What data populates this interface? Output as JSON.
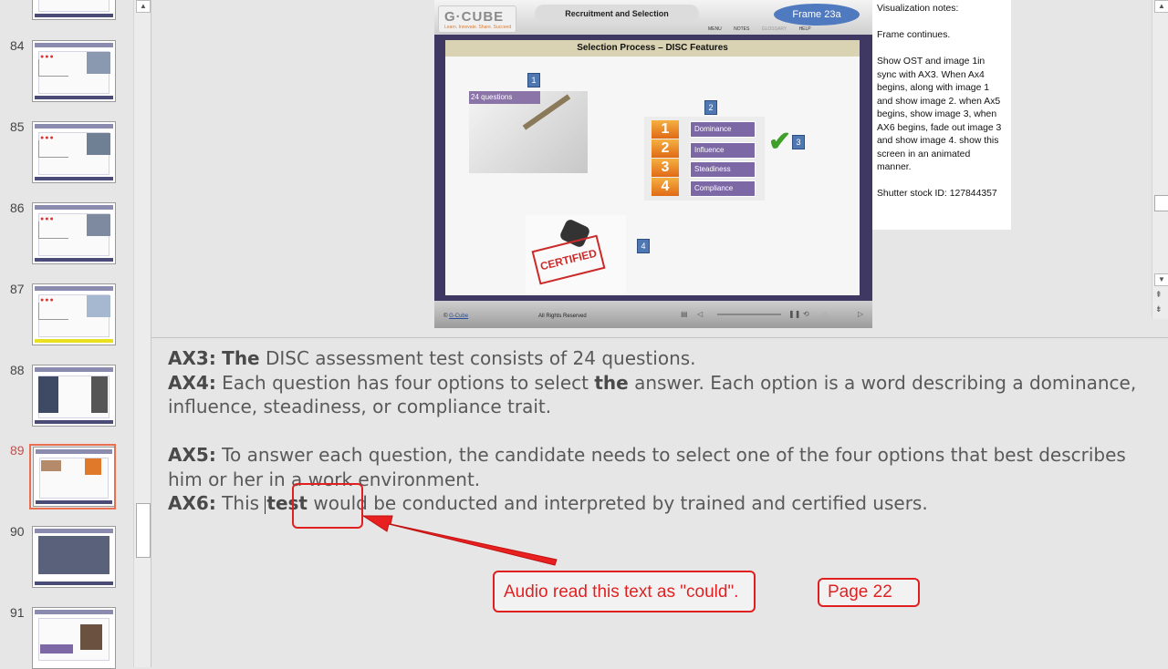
{
  "thumbnails": [
    {
      "number": "84"
    },
    {
      "number": "85"
    },
    {
      "number": "86"
    },
    {
      "number": "87"
    },
    {
      "number": "88"
    },
    {
      "number": "89",
      "selected": true
    },
    {
      "number": "90"
    },
    {
      "number": "91"
    }
  ],
  "slide": {
    "logo": "G·CUBE",
    "logo_tagline": "Learn. Innovate. Share. Succeed",
    "course_title": "Recruitment and Selection",
    "frame_label": "Frame 23a",
    "menu": {
      "menu": "MENU",
      "notes": "NOTES",
      "glossary": "GLOSSARY",
      "help": "HELP"
    },
    "title": "Selection Process – DISC Features",
    "image1_label": "24 questions",
    "markers": [
      "1",
      "2",
      "3",
      "4"
    ],
    "disc_options": [
      {
        "number": "1",
        "label": "Dominance"
      },
      {
        "number": "2",
        "label": "Influence"
      },
      {
        "number": "3",
        "label": "Steadiness"
      },
      {
        "number": "4",
        "label": "Compliance"
      }
    ],
    "stamp_text": "CERTIFIED",
    "copyright_prefix": "© ",
    "copyright_link": "G-Cube",
    "rights": "All Rights Reserved"
  },
  "visualization_notes": {
    "heading": "Visualization notes:",
    "line1": "Frame continues.",
    "paragraph": "Show OST and image 1in sync with AX3. When Ax4 begins, along with image 1 and show image 2. when Ax5 begins, show image 3, when AX6 begins, fade out image 3 and show image 4. show this screen in an animated manner.",
    "stock_id": "Shutter stock ID: 127844357"
  },
  "notes": {
    "ax3_label": "AX3:",
    "ax3_bold": "The",
    "ax3_text": " DISC assessment test consists of 24 questions.",
    "ax4_label": "AX4:",
    "ax4_text_a": " Each question has four options to select ",
    "ax4_bold": "the",
    "ax4_text_b": " answer. Each option is a word describing a dominance, influence, steadiness, or compliance trait.",
    "ax5_label": "AX5:",
    "ax5_text": " To answer each question, the candidate needs to select one of the four options that best describes him or her in a work environment.",
    "ax6_label": "AX6:",
    "ax6_text_a": " This ",
    "ax6_bold": "test",
    "ax6_text_b": " would be conducted and interpreted by trained and certified users."
  },
  "annotations": {
    "callout_main": "Audio read this text as \"could\".",
    "callout_page": "Page 22"
  }
}
